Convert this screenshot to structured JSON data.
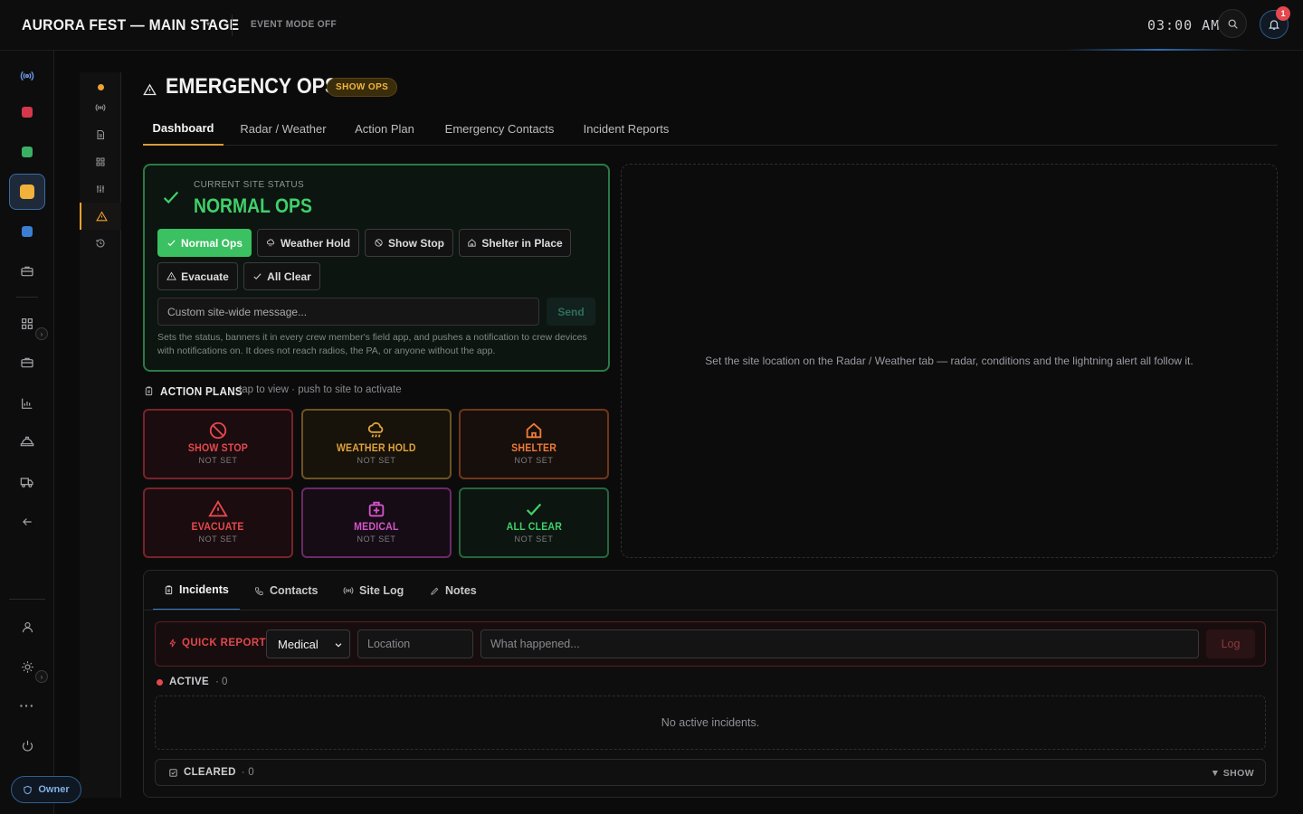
{
  "topbar": {
    "title": "AURORA FEST — MAIN STAGE",
    "event_mode": "EVENT MODE OFF",
    "clock": "03:00 AM",
    "notification_count": "1"
  },
  "rail": {
    "icons": [
      "radio-icon",
      "red-square",
      "green-square",
      "amber-square",
      "blue-square",
      "toolbox-icon",
      "grid-icon",
      "briefcase-icon",
      "chart-icon",
      "hardhat-icon",
      "truck-icon",
      "arrow-left-icon",
      "user-icon",
      "sun-icon",
      "more-icon",
      "power-icon"
    ],
    "owner_label": "Owner"
  },
  "page": {
    "title": "EMERGENCY OPS",
    "badge": "SHOW OPS"
  },
  "tabs": [
    "Dashboard",
    "Radar / Weather",
    "Action Plan",
    "Emergency Contacts",
    "Incident Reports"
  ],
  "status": {
    "caption": "CURRENT SITE STATUS",
    "value": "NORMAL OPS",
    "chips": [
      "Normal Ops",
      "Weather Hold",
      "Show Stop",
      "Shelter in Place",
      "Evacuate",
      "All Clear"
    ],
    "message_placeholder": "Custom site-wide message...",
    "send_label": "Send",
    "help": "Sets the status, banners it in every crew member's field app, and pushes a notification to crew devices with notifications on. It does not reach radios, the PA, or anyone without the app."
  },
  "radar": {
    "message": "Set the site location on the Radar / Weather tab — radar, conditions and the lightning alert all follow it."
  },
  "action_plans": {
    "title": "ACTION PLANS",
    "subtitle": "tap to view · push to site to activate",
    "plans": [
      {
        "name": "SHOW STOP",
        "status": "NOT SET",
        "color": "#e5484d"
      },
      {
        "name": "WEATHER HOLD",
        "status": "NOT SET",
        "color": "#e0a23a"
      },
      {
        "name": "SHELTER",
        "status": "NOT SET",
        "color": "#ee7a3a"
      },
      {
        "name": "EVACUATE",
        "status": "NOT SET",
        "color": "#e5484d"
      },
      {
        "name": "MEDICAL",
        "status": "NOT SET",
        "color": "#d454c8"
      },
      {
        "name": "ALL CLEAR",
        "status": "NOT SET",
        "color": "#3fd06a"
      }
    ]
  },
  "bottom": {
    "tabs": [
      "Incidents",
      "Contacts",
      "Site Log",
      "Notes"
    ],
    "quick_report": {
      "label": "QUICK REPORT",
      "type_value": "Medical",
      "location_placeholder": "Location",
      "what_placeholder": "What happened...",
      "log_label": "Log"
    },
    "active_label": "ACTIVE",
    "active_count": "· 0",
    "empty_message": "No active incidents.",
    "cleared_label": "CLEARED",
    "cleared_count": "· 0",
    "show_label": "▼ SHOW"
  },
  "colors": {
    "accent_green": "#3fd06a",
    "accent_amber": "#f0a030",
    "accent_red": "#e5484d",
    "accent_blue": "#3b7fc8"
  }
}
